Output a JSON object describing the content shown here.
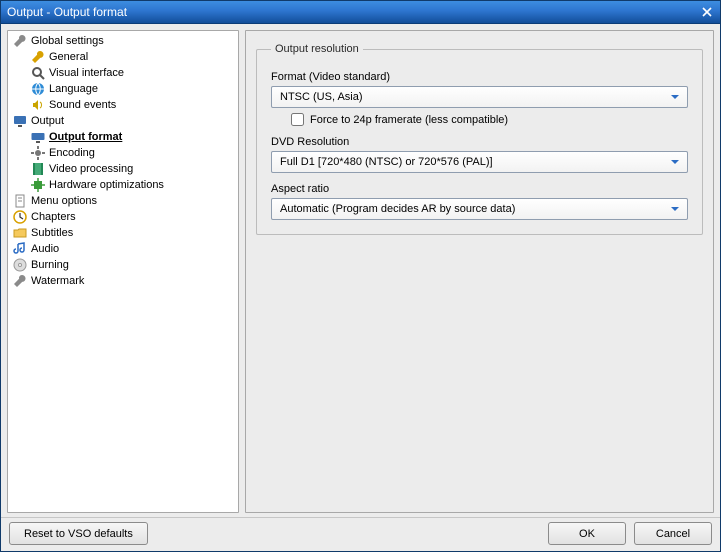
{
  "window": {
    "title": "Output - Output format"
  },
  "sidebar": {
    "items": [
      {
        "label": "Global settings",
        "level": 0,
        "icon": "wrench",
        "selected": false,
        "name": "tree-global-settings"
      },
      {
        "label": "General",
        "level": 1,
        "icon": "wrench-gold",
        "selected": false,
        "name": "tree-general"
      },
      {
        "label": "Visual interface",
        "level": 1,
        "icon": "magnifier",
        "selected": false,
        "name": "tree-visual-interface"
      },
      {
        "label": "Language",
        "level": 1,
        "icon": "globe",
        "selected": false,
        "name": "tree-language"
      },
      {
        "label": "Sound events",
        "level": 1,
        "icon": "speaker",
        "selected": false,
        "name": "tree-sound-events"
      },
      {
        "label": "Output",
        "level": 0,
        "icon": "monitor",
        "selected": false,
        "name": "tree-output"
      },
      {
        "label": "Output format",
        "level": 1,
        "icon": "monitor-wide",
        "selected": true,
        "name": "tree-output-format"
      },
      {
        "label": "Encoding",
        "level": 1,
        "icon": "cog",
        "selected": false,
        "name": "tree-encoding"
      },
      {
        "label": "Video processing",
        "level": 1,
        "icon": "film",
        "selected": false,
        "name": "tree-video-processing"
      },
      {
        "label": "Hardware optimizations",
        "level": 1,
        "icon": "chip",
        "selected": false,
        "name": "tree-hardware-optimizations"
      },
      {
        "label": "Menu options",
        "level": 0,
        "icon": "doc",
        "selected": false,
        "name": "tree-menu-options"
      },
      {
        "label": "Chapters",
        "level": 0,
        "icon": "clock",
        "selected": false,
        "name": "tree-chapters"
      },
      {
        "label": "Subtitles",
        "level": 0,
        "icon": "folder",
        "selected": false,
        "name": "tree-subtitles"
      },
      {
        "label": "Audio",
        "level": 0,
        "icon": "note",
        "selected": false,
        "name": "tree-audio"
      },
      {
        "label": "Burning",
        "level": 0,
        "icon": "disc",
        "selected": false,
        "name": "tree-burning"
      },
      {
        "label": "Watermark",
        "level": 0,
        "icon": "wrench",
        "selected": false,
        "name": "tree-watermark"
      }
    ]
  },
  "panel": {
    "group_title": "Output resolution",
    "format_label": "Format (Video standard)",
    "format_value": "NTSC (US, Asia)",
    "force24p_label": "Force to 24p framerate (less compatible)",
    "force24p_checked": false,
    "dvd_label": "DVD Resolution",
    "dvd_value": "Full D1 [720*480 (NTSC) or 720*576 (PAL)]",
    "aspect_label": "Aspect ratio",
    "aspect_value": "Automatic (Program decides AR by source data)"
  },
  "footer": {
    "reset_label": "Reset to VSO defaults",
    "ok_label": "OK",
    "cancel_label": "Cancel"
  }
}
